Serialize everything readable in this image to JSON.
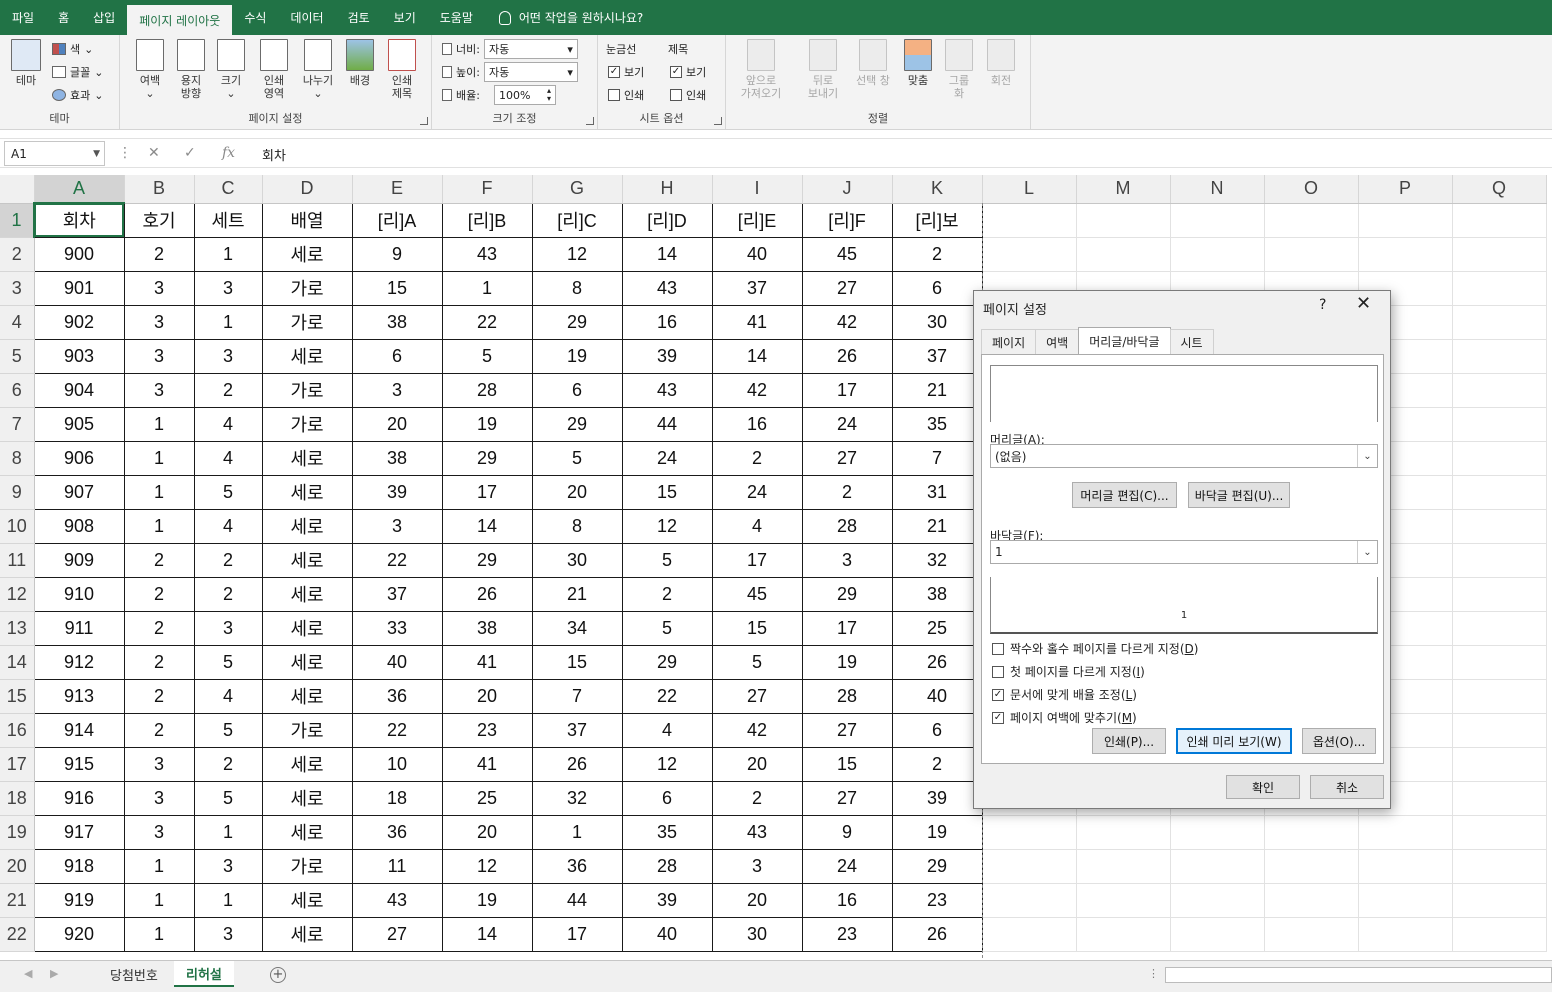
{
  "ribbon_tabs": [
    {
      "label": "파일",
      "active": false
    },
    {
      "label": "홈",
      "active": false
    },
    {
      "label": "삽입",
      "active": false
    },
    {
      "label": "페이지 레이아웃",
      "active": true
    },
    {
      "label": "수식",
      "active": false
    },
    {
      "label": "데이터",
      "active": false
    },
    {
      "label": "검토",
      "active": false
    },
    {
      "label": "보기",
      "active": false
    },
    {
      "label": "도움말",
      "active": false
    }
  ],
  "tell_me": "어떤 작업을 원하시나요?",
  "ribbon": {
    "themes": {
      "group": "테마",
      "themes_btn": "테마",
      "colors": "색",
      "fonts": "글꼴",
      "effects": "효과"
    },
    "page_setup": {
      "group": "페이지 설정",
      "margins": "여백",
      "orientation_1": "용지",
      "orientation_2": "방향",
      "size": "크기",
      "print_area_1": "인쇄",
      "print_area_2": "영역",
      "breaks": "나누기",
      "background": "배경",
      "print_titles_1": "인쇄",
      "print_titles_2": "제목"
    },
    "scale": {
      "group": "크기 조정",
      "width_label": "너비:",
      "width_value": "자동",
      "height_label": "높이:",
      "height_value": "자동",
      "scale_label": "배율:",
      "scale_value": "100%"
    },
    "sheet_options": {
      "group": "시트 옵션",
      "gridlines": "눈금선",
      "headings": "제목",
      "grid_view": "보기",
      "grid_print": "인쇄",
      "head_view": "보기",
      "head_print": "인쇄"
    },
    "arrange": {
      "group": "정렬",
      "bring_forward_1": "앞으로",
      "bring_forward_2": "가져오기",
      "send_backward_1": "뒤로",
      "send_backward_2": "보내기",
      "selection_pane": "선택 창",
      "align": "맞춤",
      "group_btn_1": "그룹",
      "group_btn_2": "화",
      "rotate": "회전"
    }
  },
  "formula_bar": {
    "name_box": "A1",
    "formula": "회차",
    "fx": "fx"
  },
  "columns": [
    "A",
    "B",
    "C",
    "D",
    "E",
    "F",
    "G",
    "H",
    "I",
    "J",
    "K",
    "L",
    "M",
    "N",
    "O",
    "P",
    "Q"
  ],
  "rows": [
    [
      "회차",
      "호기",
      "세트",
      "배열",
      "[리]A",
      "[리]B",
      "[리]C",
      "[리]D",
      "[리]E",
      "[리]F",
      "[리]보"
    ],
    [
      "900",
      "2",
      "1",
      "세로",
      "9",
      "43",
      "12",
      "14",
      "40",
      "45",
      "2"
    ],
    [
      "901",
      "3",
      "3",
      "가로",
      "15",
      "1",
      "8",
      "43",
      "37",
      "27",
      "6"
    ],
    [
      "902",
      "3",
      "1",
      "가로",
      "38",
      "22",
      "29",
      "16",
      "41",
      "42",
      "30"
    ],
    [
      "903",
      "3",
      "3",
      "세로",
      "6",
      "5",
      "19",
      "39",
      "14",
      "26",
      "37"
    ],
    [
      "904",
      "3",
      "2",
      "가로",
      "3",
      "28",
      "6",
      "43",
      "42",
      "17",
      "21"
    ],
    [
      "905",
      "1",
      "4",
      "가로",
      "20",
      "19",
      "29",
      "44",
      "16",
      "24",
      "35"
    ],
    [
      "906",
      "1",
      "4",
      "세로",
      "38",
      "29",
      "5",
      "24",
      "2",
      "27",
      "7"
    ],
    [
      "907",
      "1",
      "5",
      "세로",
      "39",
      "17",
      "20",
      "15",
      "24",
      "2",
      "31"
    ],
    [
      "908",
      "1",
      "4",
      "세로",
      "3",
      "14",
      "8",
      "12",
      "4",
      "28",
      "21"
    ],
    [
      "909",
      "2",
      "2",
      "세로",
      "22",
      "29",
      "30",
      "5",
      "17",
      "3",
      "32"
    ],
    [
      "910",
      "2",
      "2",
      "세로",
      "37",
      "26",
      "21",
      "2",
      "45",
      "29",
      "38"
    ],
    [
      "911",
      "2",
      "3",
      "세로",
      "33",
      "38",
      "34",
      "5",
      "15",
      "17",
      "25"
    ],
    [
      "912",
      "2",
      "5",
      "세로",
      "40",
      "41",
      "15",
      "29",
      "5",
      "19",
      "26"
    ],
    [
      "913",
      "2",
      "4",
      "세로",
      "36",
      "20",
      "7",
      "22",
      "27",
      "28",
      "40"
    ],
    [
      "914",
      "2",
      "5",
      "가로",
      "22",
      "23",
      "37",
      "4",
      "42",
      "27",
      "6"
    ],
    [
      "915",
      "3",
      "2",
      "세로",
      "10",
      "41",
      "26",
      "12",
      "20",
      "15",
      "2"
    ],
    [
      "916",
      "3",
      "5",
      "세로",
      "18",
      "25",
      "32",
      "6",
      "2",
      "27",
      "39"
    ],
    [
      "917",
      "3",
      "1",
      "세로",
      "36",
      "20",
      "1",
      "35",
      "43",
      "9",
      "19"
    ],
    [
      "918",
      "1",
      "3",
      "가로",
      "11",
      "12",
      "36",
      "28",
      "3",
      "24",
      "29"
    ],
    [
      "919",
      "1",
      "1",
      "세로",
      "43",
      "19",
      "44",
      "39",
      "20",
      "16",
      "23"
    ],
    [
      "920",
      "1",
      "3",
      "세로",
      "27",
      "14",
      "17",
      "40",
      "30",
      "23",
      "26"
    ]
  ],
  "sheet_tabs": [
    {
      "label": "당첨번호",
      "active": false
    },
    {
      "label": "리허설",
      "active": true
    }
  ],
  "dialog": {
    "title": "페이지 설정",
    "help": "?",
    "tabs": [
      {
        "label": "페이지",
        "active": false
      },
      {
        "label": "여백",
        "active": false
      },
      {
        "label": "머리글/바닥글",
        "active": true
      },
      {
        "label": "시트",
        "active": false
      }
    ],
    "header_label": "머리글",
    "header_key": "A",
    "header_value": "(없음)",
    "edit_header": "머리글 편집(C)...",
    "edit_footer": "바닥글 편집(U)...",
    "footer_label": "바닥글",
    "footer_key": "F",
    "footer_value": "1",
    "footer_preview": "1",
    "checks": [
      {
        "label": "짝수와 홀수 페이지를 다르게 지정",
        "key": "D",
        "checked": false
      },
      {
        "label": "첫 페이지를 다르게 지정",
        "key": "I",
        "checked": false
      },
      {
        "label": "문서에 맞게 배율 조정",
        "key": "L",
        "checked": true
      },
      {
        "label": "페이지 여백에 맞추기",
        "key": "M",
        "checked": true
      }
    ],
    "print_btn": "인쇄(P)...",
    "preview_btn": "인쇄 미리 보기(W)",
    "options_btn": "옵션(O)...",
    "ok_btn": "확인",
    "cancel_btn": "취소"
  }
}
